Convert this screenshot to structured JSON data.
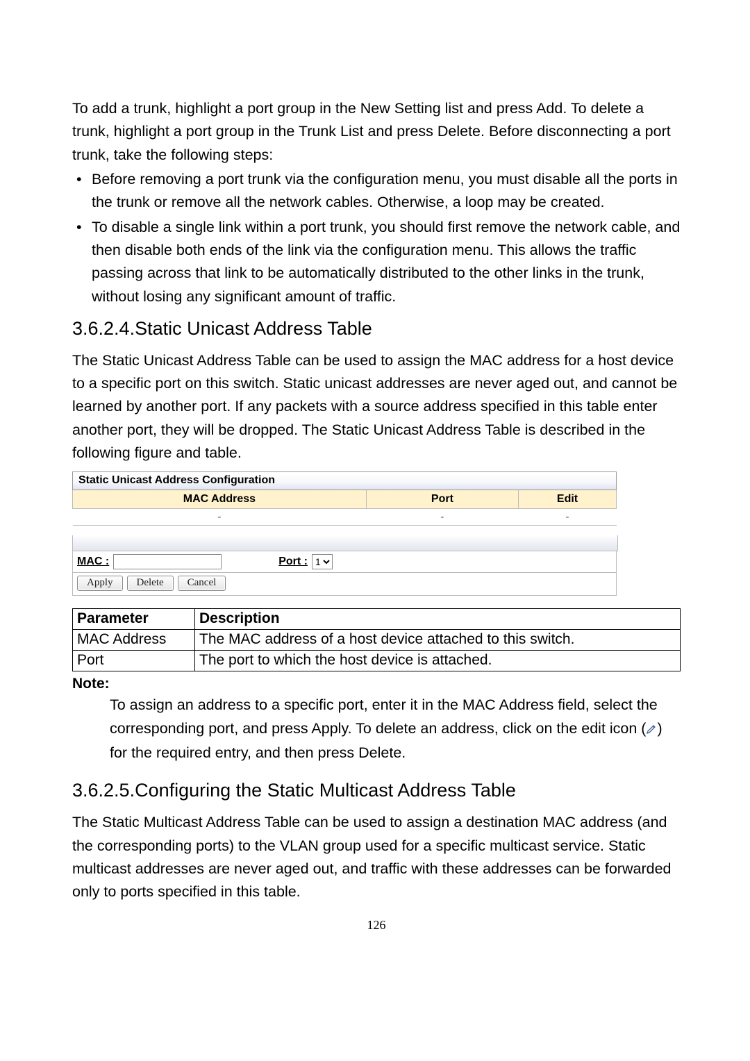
{
  "intro": "To add a trunk, highlight a port group in the New Setting list and press Add. To delete a trunk, highlight a port group in the Trunk List and press Delete. Before disconnecting a port trunk, take the following steps:",
  "bullets": [
    "Before removing a port trunk via the configuration menu, you must disable all the ports in the trunk or remove all the network cables. Otherwise, a loop may be created.",
    "To disable a single link within a port trunk, you should first remove the network cable, and then disable both ends of the link via the configuration menu. This allows the traffic passing across that link to be automatically distributed to the other links in the trunk, without losing any significant amount of traffic."
  ],
  "section1": {
    "heading": "3.6.2.4.Static Unicast Address Table",
    "para": "The Static Unicast Address Table can be used to assign the MAC address for a host device to a specific port on this switch. Static unicast addresses are never aged out, and cannot be learned by another port. If any packets with a source address specified in this table enter another port, they will be dropped. The Static Unicast Address Table is described in the following figure and table."
  },
  "ui": {
    "banner": "Static Unicast Address Configuration",
    "cols": {
      "mac": "MAC Address",
      "port": "Port",
      "edit": "Edit"
    },
    "row": {
      "mac": "-",
      "port": "-",
      "edit": "-"
    },
    "form": {
      "mac_label": "MAC :",
      "port_label": "Port :",
      "port_value": "1"
    },
    "buttons": {
      "apply": "Apply",
      "delete": "Delete",
      "cancel": "Cancel"
    }
  },
  "desc": {
    "head": {
      "param": "Parameter",
      "desc": "Description"
    },
    "rows": [
      {
        "param": "MAC Address",
        "desc": "The MAC address of a host device attached to this switch."
      },
      {
        "param": "Port",
        "desc": "The port to which the host device is attached."
      }
    ]
  },
  "note": {
    "label": "Note:",
    "body_before": "To assign an address to a specific port, enter it in the MAC Address field, select the corresponding port, and press Apply. To delete an address, click on the edit icon (",
    "body_after": ") for the required entry, and then press Delete."
  },
  "section2": {
    "heading": "3.6.2.5.Configuring the Static Multicast Address Table",
    "para": "The Static Multicast Address Table can be used to assign a destination MAC address (and the corresponding ports) to the VLAN group used for a specific multicast service. Static multicast addresses are never aged out, and traffic with these addresses can be forwarded only to ports specified in this table."
  },
  "page_number": "126"
}
